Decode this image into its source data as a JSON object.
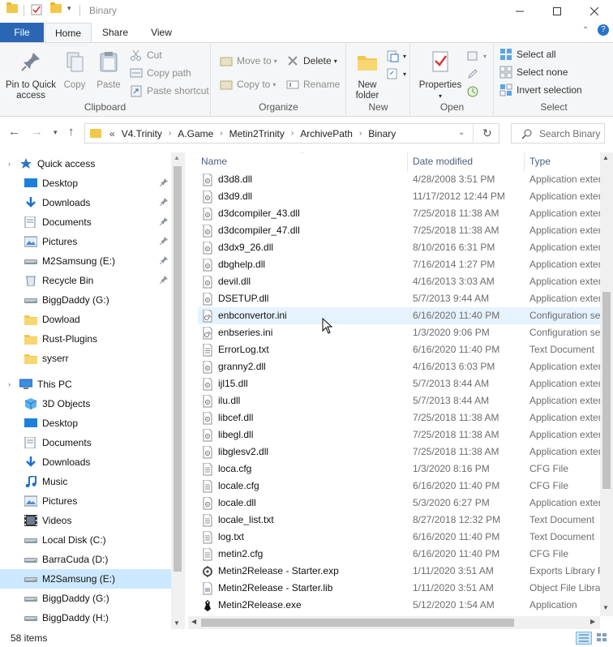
{
  "window": {
    "title": "Binary"
  },
  "tabs": {
    "file": "File",
    "home": "Home",
    "share": "Share",
    "view": "View"
  },
  "ribbon": {
    "clipboard": {
      "label": "Clipboard",
      "pin": "Pin to Quick access",
      "copy": "Copy",
      "paste": "Paste",
      "cut": "Cut",
      "copy_path": "Copy path",
      "paste_shortcut": "Paste shortcut"
    },
    "organize": {
      "label": "Organize",
      "move_to": "Move to",
      "copy_to": "Copy to",
      "delete": "Delete",
      "rename": "Rename"
    },
    "new": {
      "label": "New",
      "new_folder": "New folder"
    },
    "open": {
      "label": "Open",
      "properties": "Properties"
    },
    "select": {
      "label": "Select",
      "select_all": "Select all",
      "select_none": "Select none",
      "invert": "Invert selection"
    }
  },
  "address": {
    "prefix": "«",
    "crumbs": [
      "V4.Trinity",
      "A.Game",
      "Metin2Trinity",
      "ArchivePath",
      "Binary"
    ],
    "search_placeholder": "Search Binary"
  },
  "nav": {
    "items": [
      {
        "label": "Quick access",
        "icon": "star-icon",
        "pinned": false
      },
      {
        "label": "Desktop",
        "icon": "desktop-icon",
        "pinned": true
      },
      {
        "label": "Downloads",
        "icon": "download-icon",
        "pinned": true
      },
      {
        "label": "Documents",
        "icon": "documents-icon",
        "pinned": true
      },
      {
        "label": "Pictures",
        "icon": "pictures-icon",
        "pinned": true
      },
      {
        "label": "M2Samsung (E:)",
        "icon": "drive-icon",
        "pinned": true
      },
      {
        "label": "Recycle Bin",
        "icon": "recycle-bin-icon",
        "pinned": true
      },
      {
        "label": "BiggDaddy (G:)",
        "icon": "drive-icon",
        "pinned": false
      },
      {
        "label": "Dowload",
        "icon": "folder-icon",
        "pinned": false
      },
      {
        "label": "Rust-Plugins",
        "icon": "folder-icon",
        "pinned": false
      },
      {
        "label": "syserr",
        "icon": "folder-icon",
        "pinned": false
      },
      {
        "label": "This PC",
        "icon": "computer-icon",
        "pinned": false
      },
      {
        "label": "3D Objects",
        "icon": "3d-objects-icon",
        "pinned": false
      },
      {
        "label": "Desktop",
        "icon": "desktop-icon",
        "pinned": false
      },
      {
        "label": "Documents",
        "icon": "documents-icon",
        "pinned": false
      },
      {
        "label": "Downloads",
        "icon": "download-icon",
        "pinned": false
      },
      {
        "label": "Music",
        "icon": "music-icon",
        "pinned": false
      },
      {
        "label": "Pictures",
        "icon": "pictures-icon",
        "pinned": false
      },
      {
        "label": "Videos",
        "icon": "videos-icon",
        "pinned": false
      },
      {
        "label": "Local Disk (C:)",
        "icon": "drive-icon",
        "pinned": false
      },
      {
        "label": "BarraCuda (D:)",
        "icon": "drive-icon",
        "pinned": false
      },
      {
        "label": "M2Samsung (E:)",
        "icon": "drive-icon",
        "pinned": false,
        "selected": true
      },
      {
        "label": "BiggDaddy (G:)",
        "icon": "drive-icon",
        "pinned": false
      },
      {
        "label": "BiggDaddy (H:)",
        "icon": "drive-icon",
        "pinned": false
      }
    ]
  },
  "columns": {
    "name": "Name",
    "date": "Date modified",
    "type": "Type"
  },
  "files": [
    {
      "name": "d3d8.dll",
      "date": "4/28/2008 3:51 PM",
      "type": "Application extension",
      "icon": "dll-file-icon"
    },
    {
      "name": "d3d9.dll",
      "date": "11/17/2012 12:44 PM",
      "type": "Application extension",
      "icon": "dll-file-icon"
    },
    {
      "name": "d3dcompiler_43.dll",
      "date": "7/25/2018 11:38 AM",
      "type": "Application extension",
      "icon": "dll-file-icon"
    },
    {
      "name": "d3dcompiler_47.dll",
      "date": "7/25/2018 11:38 AM",
      "type": "Application extension",
      "icon": "dll-file-icon"
    },
    {
      "name": "d3dx9_26.dll",
      "date": "8/10/2016 6:31 PM",
      "type": "Application extension",
      "icon": "dll-file-icon"
    },
    {
      "name": "dbghelp.dll",
      "date": "7/16/2014 1:27 PM",
      "type": "Application extension",
      "icon": "dll-file-icon"
    },
    {
      "name": "devil.dll",
      "date": "4/16/2013 3:03 AM",
      "type": "Application extension",
      "icon": "dll-file-icon"
    },
    {
      "name": "DSETUP.dll",
      "date": "5/7/2013 9:44 AM",
      "type": "Application extension",
      "icon": "dll-file-icon"
    },
    {
      "name": "enbconvertor.ini",
      "date": "6/16/2020 11:40 PM",
      "type": "Configuration settings",
      "icon": "ini-file-icon"
    },
    {
      "name": "enbseries.ini",
      "date": "1/3/2020 9:06 PM",
      "type": "Configuration settings",
      "icon": "ini-file-icon"
    },
    {
      "name": "ErrorLog.txt",
      "date": "6/16/2020 11:40 PM",
      "type": "Text Document",
      "icon": "text-file-icon"
    },
    {
      "name": "granny2.dll",
      "date": "4/16/2013 6:03 PM",
      "type": "Application extension",
      "icon": "dll-file-icon"
    },
    {
      "name": "ijl15.dll",
      "date": "5/7/2013 8:44 AM",
      "type": "Application extension",
      "icon": "dll-file-icon"
    },
    {
      "name": "ilu.dll",
      "date": "5/7/2013 8:44 AM",
      "type": "Application extension",
      "icon": "dll-file-icon"
    },
    {
      "name": "libcef.dll",
      "date": "7/25/2018 11:38 AM",
      "type": "Application extension",
      "icon": "dll-file-icon"
    },
    {
      "name": "libegl.dll",
      "date": "7/25/2018 11:38 AM",
      "type": "Application extension",
      "icon": "dll-file-icon"
    },
    {
      "name": "libglesv2.dll",
      "date": "7/25/2018 11:38 AM",
      "type": "Application extension",
      "icon": "dll-file-icon"
    },
    {
      "name": "loca.cfg",
      "date": "1/3/2020 8:16 PM",
      "type": "CFG File",
      "icon": "text-file-icon"
    },
    {
      "name": "locale.cfg",
      "date": "6/16/2020 11:40 PM",
      "type": "CFG File",
      "icon": "text-file-icon"
    },
    {
      "name": "locale.dll",
      "date": "5/3/2020 6:27 PM",
      "type": "Application extension",
      "icon": "dll-file-icon"
    },
    {
      "name": "locale_list.txt",
      "date": "8/27/2018 12:32 PM",
      "type": "Text Document",
      "icon": "text-file-icon"
    },
    {
      "name": "log.txt",
      "date": "6/16/2020 11:40 PM",
      "type": "Text Document",
      "icon": "text-file-icon"
    },
    {
      "name": "metin2.cfg",
      "date": "6/16/2020 11:40 PM",
      "type": "CFG File",
      "icon": "text-file-icon"
    },
    {
      "name": "Metin2Release - Starter.exp",
      "date": "1/11/2020 3:51 AM",
      "type": "Exports Library File",
      "icon": "exp-file-icon"
    },
    {
      "name": "Metin2Release - Starter.lib",
      "date": "1/11/2020 3:51 AM",
      "type": "Object File Library",
      "icon": "lib-file-icon"
    },
    {
      "name": "Metin2Release.exe",
      "date": "5/12/2020 1:54 AM",
      "type": "Application",
      "icon": "exe-file-icon"
    }
  ],
  "status": {
    "count": "58 items"
  }
}
